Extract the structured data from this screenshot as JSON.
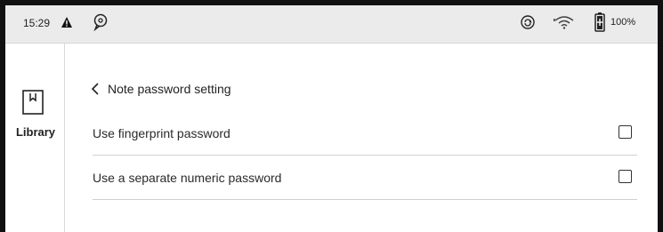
{
  "status_bar": {
    "time": "15:29",
    "battery_percent": "100%",
    "icons": [
      "warning-icon",
      "chat-icon",
      "sync-icon",
      "wifi-icon",
      "battery-icon"
    ]
  },
  "sidebar": {
    "items": [
      {
        "label": "Library",
        "icon": "library-icon"
      }
    ]
  },
  "page": {
    "title": "Note password setting",
    "back_icon": "chevron-left-icon"
  },
  "settings": [
    {
      "label": "Use fingerprint password",
      "checked": false
    },
    {
      "label": "Use a separate numeric password",
      "checked": false
    }
  ]
}
